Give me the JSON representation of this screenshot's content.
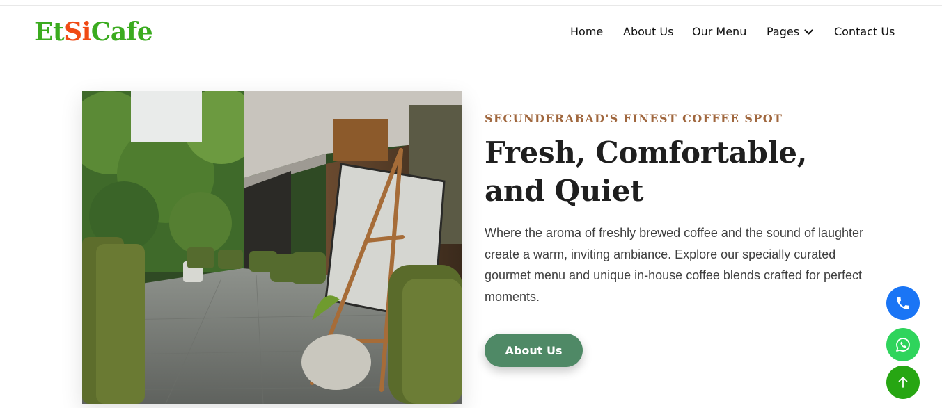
{
  "logo": {
    "part1": "Et",
    "part2": "Si",
    "part3": "Cafe"
  },
  "nav": {
    "home": "Home",
    "about": "About Us",
    "menu": "Our Menu",
    "pages": "Pages",
    "contact": "Contact Us"
  },
  "hero": {
    "eyebrow": "SECUNDERABAD'S FINEST COFFEE SPOT",
    "headline_line1": "Fresh, Comfortable,",
    "headline_line2": "and Quiet",
    "description": "Where the aroma of freshly brewed coffee and the sound of laughter create a warm, inviting ambiance. Explore our specially curated gourmet menu and unique in-house coffee blends crafted for perfect moments.",
    "button_label": "About Us"
  },
  "floating_buttons": {
    "phone_icon": "phone-icon",
    "whatsapp_icon": "whatsapp-icon",
    "top_icon": "arrow-up-icon"
  },
  "colors": {
    "logo_green": "#3bab1f",
    "logo_orange": "#f04a14",
    "eyebrow": "#a0673e",
    "button_green": "#4f8966",
    "phone_blue": "#1a75f5",
    "whatsapp_green": "#2fd45c",
    "top_green": "#27a613"
  }
}
